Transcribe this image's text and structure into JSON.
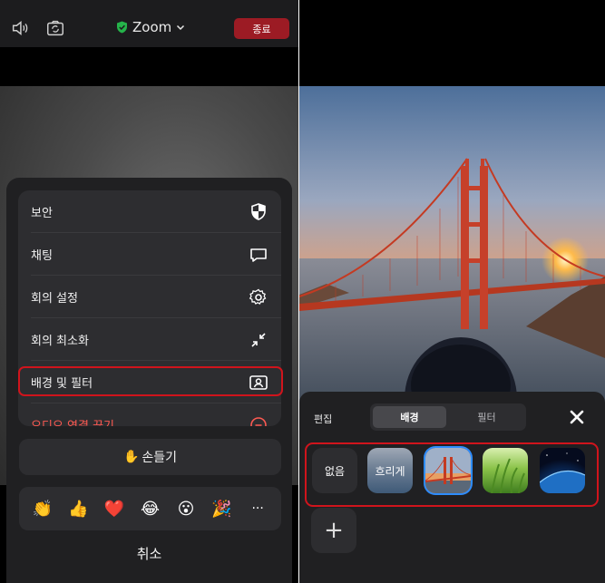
{
  "left": {
    "topbar": {
      "title": "Zoom",
      "end_label": "종료",
      "icons": [
        "speaker-icon",
        "camera-switch-icon",
        "shield-check-icon",
        "chevron-down-icon"
      ]
    },
    "menu": {
      "items": [
        {
          "label": "보안",
          "icon": "shield-icon"
        },
        {
          "label": "채팅",
          "icon": "chat-bubble-icon"
        },
        {
          "label": "회의 설정",
          "icon": "gear-icon"
        },
        {
          "label": "회의 최소화",
          "icon": "minimize-arrows-icon"
        },
        {
          "label": "배경 및 필터",
          "icon": "portrait-icon"
        },
        {
          "label": "오디오 연결 끊기",
          "icon": "disconnect-icon"
        }
      ]
    },
    "raise_hand": {
      "emoji": "✋",
      "label": "손들기"
    },
    "reactions": [
      "👏",
      "👍",
      "❤️",
      "😂",
      "😮",
      "🎉",
      "···"
    ],
    "cancel_label": "취소",
    "colors": {
      "end_button": "#9c1b24",
      "highlight": "#d0141c",
      "danger_text": "#ff5a52"
    }
  },
  "right": {
    "panel": {
      "edit_label": "편집",
      "tabs": [
        {
          "label": "배경",
          "active": true
        },
        {
          "label": "필터",
          "active": false
        }
      ],
      "close_icon": "close-icon",
      "backgrounds": [
        {
          "label": "없음",
          "kind": "none"
        },
        {
          "label": "흐리게",
          "kind": "blur"
        },
        {
          "label": "",
          "kind": "golden-gate-bridge",
          "selected": true
        },
        {
          "label": "",
          "kind": "grass"
        },
        {
          "label": "",
          "kind": "earth-from-space"
        }
      ],
      "add_label": "+"
    },
    "colors": {
      "selected_ring": "#2d8cff",
      "highlight": "#d0141c"
    }
  }
}
